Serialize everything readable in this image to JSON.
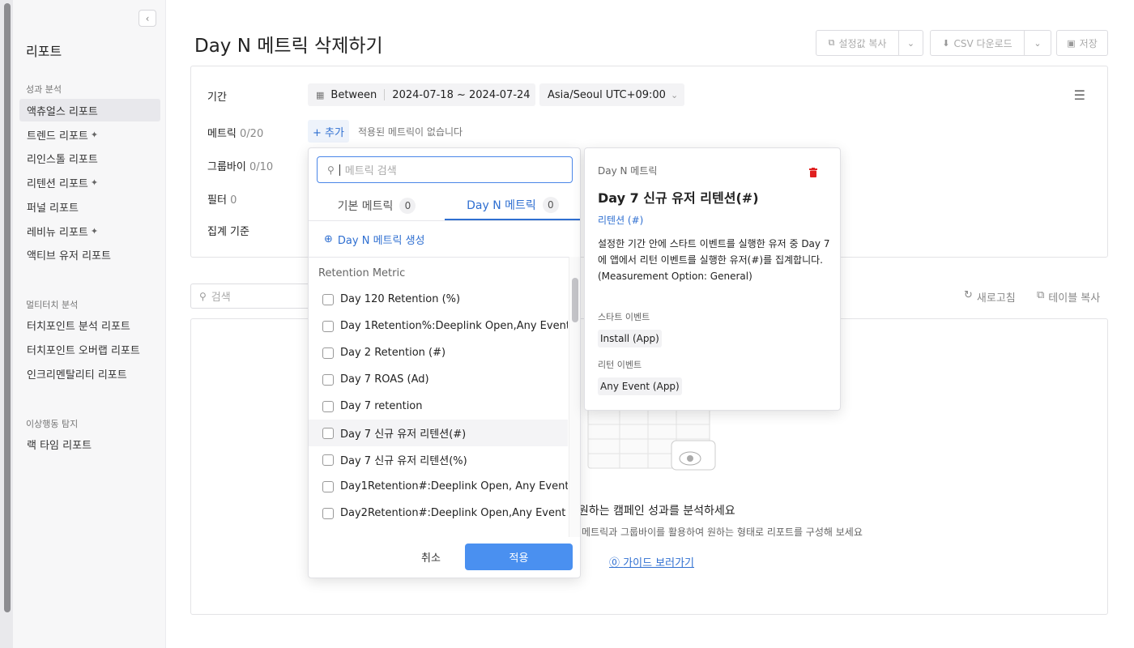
{
  "sidebar": {
    "title": "리포트",
    "sections": [
      {
        "label": "성과 분석",
        "items": [
          {
            "label": "액츄얼스 리포트",
            "spark": false
          },
          {
            "label": "트렌드 리포트",
            "spark": true
          },
          {
            "label": "리인스톨 리포트",
            "spark": false
          },
          {
            "label": "리텐션 리포트",
            "spark": true
          },
          {
            "label": "퍼널 리포트",
            "spark": false
          },
          {
            "label": "레비뉴 리포트",
            "spark": true
          },
          {
            "label": "액티브 유저 리포트",
            "spark": false
          }
        ]
      },
      {
        "label": "멀티터치 분석",
        "items": [
          {
            "label": "터치포인트 분석 리포트"
          },
          {
            "label": "터치포인트 오버랩 리포트"
          },
          {
            "label": "인크리멘탈리티 리포트"
          }
        ]
      },
      {
        "label": "이상행동 탐지",
        "items": [
          {
            "label": "랙 타임 리포트"
          }
        ]
      }
    ],
    "spark_glyph": "✦"
  },
  "header": {
    "title": "Day N 메트릭 삭제하기",
    "copy_settings": "설정값 복사",
    "csv_download": "CSV 다운로드",
    "save": "저장"
  },
  "filters": {
    "period_label": "기간",
    "period_mode": "Between",
    "period_range": "2024-07-18 ~ 2024-07-24",
    "timezone": "Asia/Seoul UTC+09:00",
    "metric_label": "메트릭",
    "metric_count": "0/20",
    "add_label": "+ 추가",
    "no_metric": "적용된 메트릭이 없습니다",
    "groupby_label": "그룹바이",
    "groupby_count": "0/10",
    "filter_label": "필터",
    "filter_count": "0",
    "aggregate_label": "집계 기준"
  },
  "table_bar": {
    "search_placeholder": "검색",
    "refresh": "새로고침",
    "table_copy": "테이블 복사"
  },
  "empty": {
    "title": "원하는 캠페인 성과를 분석하세요",
    "subtitle": "메트릭과 그룹바이를 활용하여 원하는 형태로 리포트를 구성해 보세요",
    "guide": "가이드 보러가기"
  },
  "dropdown": {
    "search_placeholder": "메트릭 검색",
    "tabs": [
      {
        "label": "기본 메트릭",
        "count": "0"
      },
      {
        "label": "Day N 메트릭",
        "count": "0"
      }
    ],
    "create_label": "Day N 메트릭 생성",
    "group_label": "Retention Metric",
    "items": [
      "Day 120 Retention (%)",
      "Day 1Retention%:Deeplink Open,Any Event",
      "Day 2 Retention (#)",
      "Day 7 ROAS (Ad)",
      "Day 7 retention",
      "Day 7 신규 유저 리텐션(#)",
      "Day 7 신규 유저 리텐션(%)",
      "Day1Retention#:Deeplink Open, Any Event",
      "Day2Retention#:Deeplink Open,Any Event"
    ],
    "highlighted_index": 5,
    "cancel": "취소",
    "apply": "적용"
  },
  "detail": {
    "header": "Day N 메트릭",
    "title": "Day 7 신규 유저 리텐션(#)",
    "type": "리텐션 (#)",
    "description": "설정한 기간 안에 스타트 이벤트를 실행한 유저 중 Day 7에 앱에서 리턴 이벤트를 실행한 유저(#)를 집계합니다.",
    "measurement": "(Measurement Option: General)",
    "start_event_label": "스타트 이벤트",
    "start_event": "Install (App)",
    "return_event_label": "리턴 이벤트",
    "return_event": "Any Event (App)"
  },
  "colors": {
    "accent": "#2f6fd1",
    "apply_button": "#4a90f0",
    "delete_icon": "#e02020"
  }
}
